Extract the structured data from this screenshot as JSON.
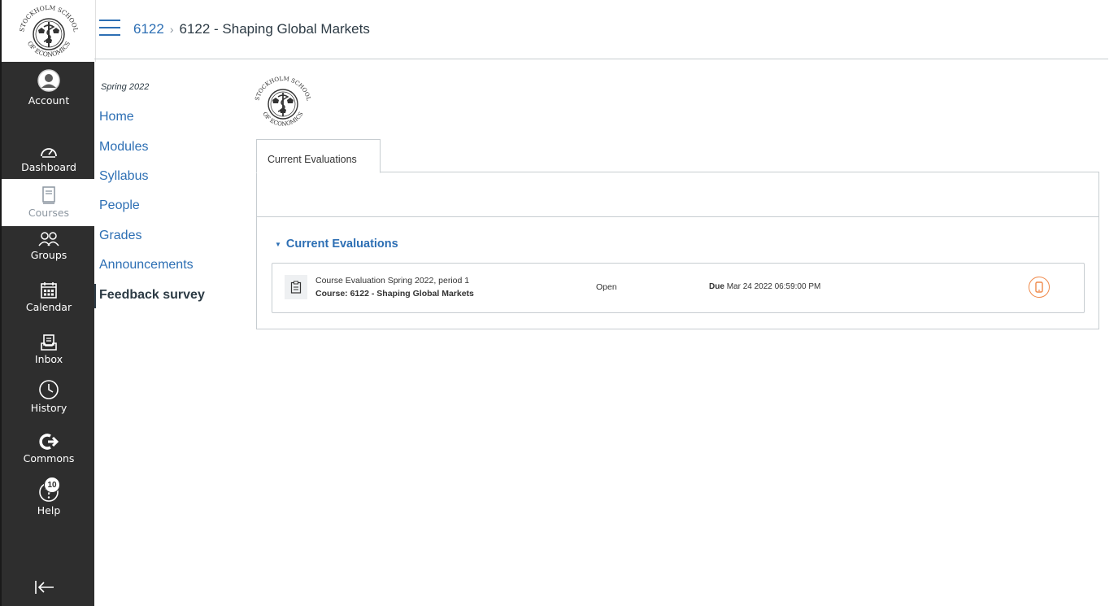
{
  "global_nav": {
    "logo_icon": "stockholm-school-of-economics-seal",
    "items": [
      {
        "label": "Account",
        "icon": "avatar-icon"
      },
      {
        "label": "Dashboard",
        "icon": "dashboard-icon"
      },
      {
        "label": "Courses",
        "icon": "courses-icon"
      },
      {
        "label": "Groups",
        "icon": "groups-icon"
      },
      {
        "label": "Calendar",
        "icon": "calendar-icon"
      },
      {
        "label": "Inbox",
        "icon": "inbox-icon"
      },
      {
        "label": "History",
        "icon": "history-icon"
      },
      {
        "label": "Commons",
        "icon": "commons-icon"
      },
      {
        "label": "Help",
        "icon": "help-icon"
      }
    ],
    "help_badge": "10",
    "collapse_icon": "collapse-arrow-icon"
  },
  "header": {
    "breadcrumb_link": "6122",
    "breadcrumb_separator": "›",
    "breadcrumb_current": "6122 - Shaping Global Markets"
  },
  "course_nav": {
    "term": "Spring 2022",
    "links": [
      "Home",
      "Modules",
      "Syllabus",
      "People",
      "Grades",
      "Announcements",
      "Feedback survey"
    ],
    "active": "Feedback survey"
  },
  "content": {
    "logo_text_top": "STOCKHOLM SCHOOL",
    "logo_text_bottom": "OF ECONOMICS",
    "tab_label": "Current Evaluations",
    "section_title": "Current Evaluations",
    "evaluation": {
      "name": "Course Evaluation Spring 2022, period 1",
      "course": "Course: 6122 - Shaping Global Markets",
      "status": "Open",
      "due_label": "Due",
      "due_date": "Mar 24 2022 06:59:00 PM"
    }
  },
  "colors": {
    "nav_bg": "#2e2e2e",
    "link": "#2d6fb4",
    "action": "#f08a4b"
  }
}
